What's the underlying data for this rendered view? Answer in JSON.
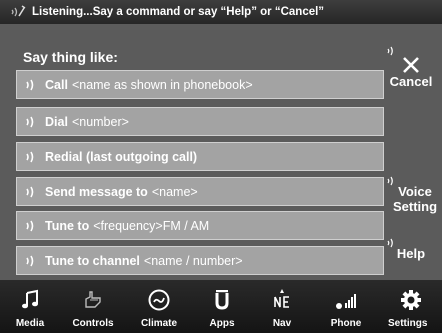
{
  "status_bar": {
    "text": "Listening...Say a command or say “Help” or “Cancel”"
  },
  "prompt": {
    "heading": "Say thing like:"
  },
  "commands": [
    {
      "label": "Call",
      "placeholder": "<name as shown in phonebook>"
    },
    {
      "label": "Dial",
      "placeholder": "<number>"
    },
    {
      "label": "Redial (last outgoing call)",
      "placeholder": ""
    },
    {
      "label": "Send message to",
      "placeholder": "<name>"
    },
    {
      "label": "Tune to",
      "placeholder": "<frequency>FM / AM"
    },
    {
      "label": "Tune to channel",
      "placeholder": "<name / number>"
    }
  ],
  "side_buttons": {
    "cancel": {
      "label": "Cancel",
      "icon": "close-icon"
    },
    "voice_setting": {
      "label": "Voice Setting"
    },
    "help": {
      "label": "Help"
    }
  },
  "bottom_nav": [
    {
      "label": "Media",
      "icon": "music-note-icon"
    },
    {
      "label": "Controls",
      "icon": "hand-icon"
    },
    {
      "label": "Climate",
      "icon": "climate-icon"
    },
    {
      "label": "Apps",
      "icon": "apps-icon"
    },
    {
      "label": "Nav",
      "icon": "compass-icon"
    },
    {
      "label": "Phone",
      "icon": "phone-signal-icon"
    },
    {
      "label": "Settings",
      "icon": "gear-icon"
    }
  ],
  "colors": {
    "panel": "#5b5b5b",
    "command_bg": "#a3a3a3",
    "background": "#000000"
  }
}
